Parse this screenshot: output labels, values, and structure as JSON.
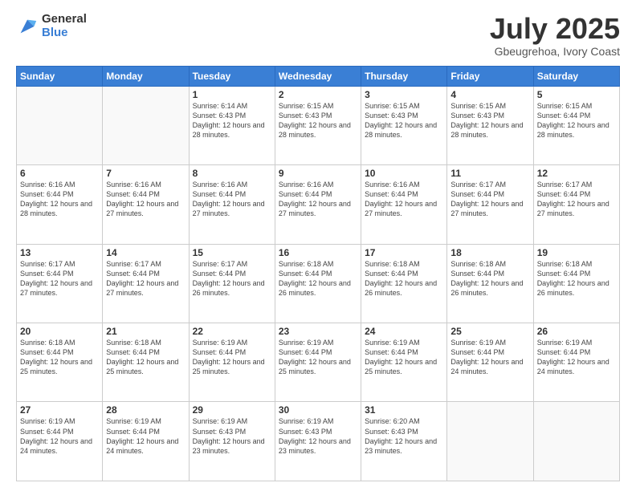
{
  "logo": {
    "general": "General",
    "blue": "Blue"
  },
  "title": "July 2025",
  "subtitle": "Gbeugrehoa, Ivory Coast",
  "days_of_week": [
    "Sunday",
    "Monday",
    "Tuesday",
    "Wednesday",
    "Thursday",
    "Friday",
    "Saturday"
  ],
  "weeks": [
    [
      {
        "day": "",
        "info": ""
      },
      {
        "day": "",
        "info": ""
      },
      {
        "day": "1",
        "info": "Sunrise: 6:14 AM\nSunset: 6:43 PM\nDaylight: 12 hours and 28 minutes."
      },
      {
        "day": "2",
        "info": "Sunrise: 6:15 AM\nSunset: 6:43 PM\nDaylight: 12 hours and 28 minutes."
      },
      {
        "day": "3",
        "info": "Sunrise: 6:15 AM\nSunset: 6:43 PM\nDaylight: 12 hours and 28 minutes."
      },
      {
        "day": "4",
        "info": "Sunrise: 6:15 AM\nSunset: 6:43 PM\nDaylight: 12 hours and 28 minutes."
      },
      {
        "day": "5",
        "info": "Sunrise: 6:15 AM\nSunset: 6:44 PM\nDaylight: 12 hours and 28 minutes."
      }
    ],
    [
      {
        "day": "6",
        "info": "Sunrise: 6:16 AM\nSunset: 6:44 PM\nDaylight: 12 hours and 28 minutes."
      },
      {
        "day": "7",
        "info": "Sunrise: 6:16 AM\nSunset: 6:44 PM\nDaylight: 12 hours and 27 minutes."
      },
      {
        "day": "8",
        "info": "Sunrise: 6:16 AM\nSunset: 6:44 PM\nDaylight: 12 hours and 27 minutes."
      },
      {
        "day": "9",
        "info": "Sunrise: 6:16 AM\nSunset: 6:44 PM\nDaylight: 12 hours and 27 minutes."
      },
      {
        "day": "10",
        "info": "Sunrise: 6:16 AM\nSunset: 6:44 PM\nDaylight: 12 hours and 27 minutes."
      },
      {
        "day": "11",
        "info": "Sunrise: 6:17 AM\nSunset: 6:44 PM\nDaylight: 12 hours and 27 minutes."
      },
      {
        "day": "12",
        "info": "Sunrise: 6:17 AM\nSunset: 6:44 PM\nDaylight: 12 hours and 27 minutes."
      }
    ],
    [
      {
        "day": "13",
        "info": "Sunrise: 6:17 AM\nSunset: 6:44 PM\nDaylight: 12 hours and 27 minutes."
      },
      {
        "day": "14",
        "info": "Sunrise: 6:17 AM\nSunset: 6:44 PM\nDaylight: 12 hours and 27 minutes."
      },
      {
        "day": "15",
        "info": "Sunrise: 6:17 AM\nSunset: 6:44 PM\nDaylight: 12 hours and 26 minutes."
      },
      {
        "day": "16",
        "info": "Sunrise: 6:18 AM\nSunset: 6:44 PM\nDaylight: 12 hours and 26 minutes."
      },
      {
        "day": "17",
        "info": "Sunrise: 6:18 AM\nSunset: 6:44 PM\nDaylight: 12 hours and 26 minutes."
      },
      {
        "day": "18",
        "info": "Sunrise: 6:18 AM\nSunset: 6:44 PM\nDaylight: 12 hours and 26 minutes."
      },
      {
        "day": "19",
        "info": "Sunrise: 6:18 AM\nSunset: 6:44 PM\nDaylight: 12 hours and 26 minutes."
      }
    ],
    [
      {
        "day": "20",
        "info": "Sunrise: 6:18 AM\nSunset: 6:44 PM\nDaylight: 12 hours and 25 minutes."
      },
      {
        "day": "21",
        "info": "Sunrise: 6:18 AM\nSunset: 6:44 PM\nDaylight: 12 hours and 25 minutes."
      },
      {
        "day": "22",
        "info": "Sunrise: 6:19 AM\nSunset: 6:44 PM\nDaylight: 12 hours and 25 minutes."
      },
      {
        "day": "23",
        "info": "Sunrise: 6:19 AM\nSunset: 6:44 PM\nDaylight: 12 hours and 25 minutes."
      },
      {
        "day": "24",
        "info": "Sunrise: 6:19 AM\nSunset: 6:44 PM\nDaylight: 12 hours and 25 minutes."
      },
      {
        "day": "25",
        "info": "Sunrise: 6:19 AM\nSunset: 6:44 PM\nDaylight: 12 hours and 24 minutes."
      },
      {
        "day": "26",
        "info": "Sunrise: 6:19 AM\nSunset: 6:44 PM\nDaylight: 12 hours and 24 minutes."
      }
    ],
    [
      {
        "day": "27",
        "info": "Sunrise: 6:19 AM\nSunset: 6:44 PM\nDaylight: 12 hours and 24 minutes."
      },
      {
        "day": "28",
        "info": "Sunrise: 6:19 AM\nSunset: 6:44 PM\nDaylight: 12 hours and 24 minutes."
      },
      {
        "day": "29",
        "info": "Sunrise: 6:19 AM\nSunset: 6:43 PM\nDaylight: 12 hours and 23 minutes."
      },
      {
        "day": "30",
        "info": "Sunrise: 6:19 AM\nSunset: 6:43 PM\nDaylight: 12 hours and 23 minutes."
      },
      {
        "day": "31",
        "info": "Sunrise: 6:20 AM\nSunset: 6:43 PM\nDaylight: 12 hours and 23 minutes."
      },
      {
        "day": "",
        "info": ""
      },
      {
        "day": "",
        "info": ""
      }
    ]
  ]
}
